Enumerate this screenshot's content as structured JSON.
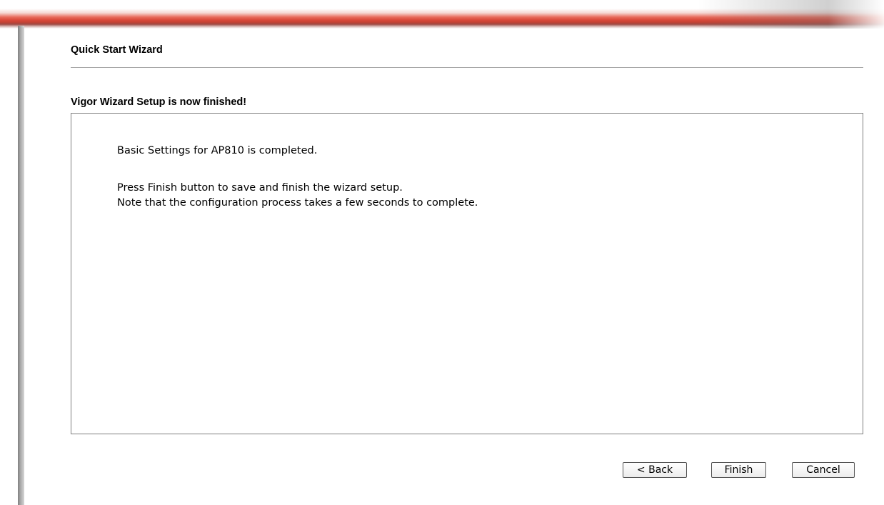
{
  "wizard": {
    "title": "Quick Start Wizard",
    "heading": "Vigor Wizard Setup is now finished!",
    "message": {
      "line1": "Basic Settings for AP810 is completed.",
      "line2": "Press Finish button to save and finish the wizard setup.",
      "line3": "Note that the configuration process takes a few seconds to complete."
    },
    "buttons": {
      "back_label": "< Back",
      "finish_label": "Finish",
      "cancel_label": "Cancel"
    }
  },
  "colors": {
    "accent_bar": "#d9483a",
    "divider": "#a8a8a8",
    "box_border": "#7f7f7f"
  }
}
